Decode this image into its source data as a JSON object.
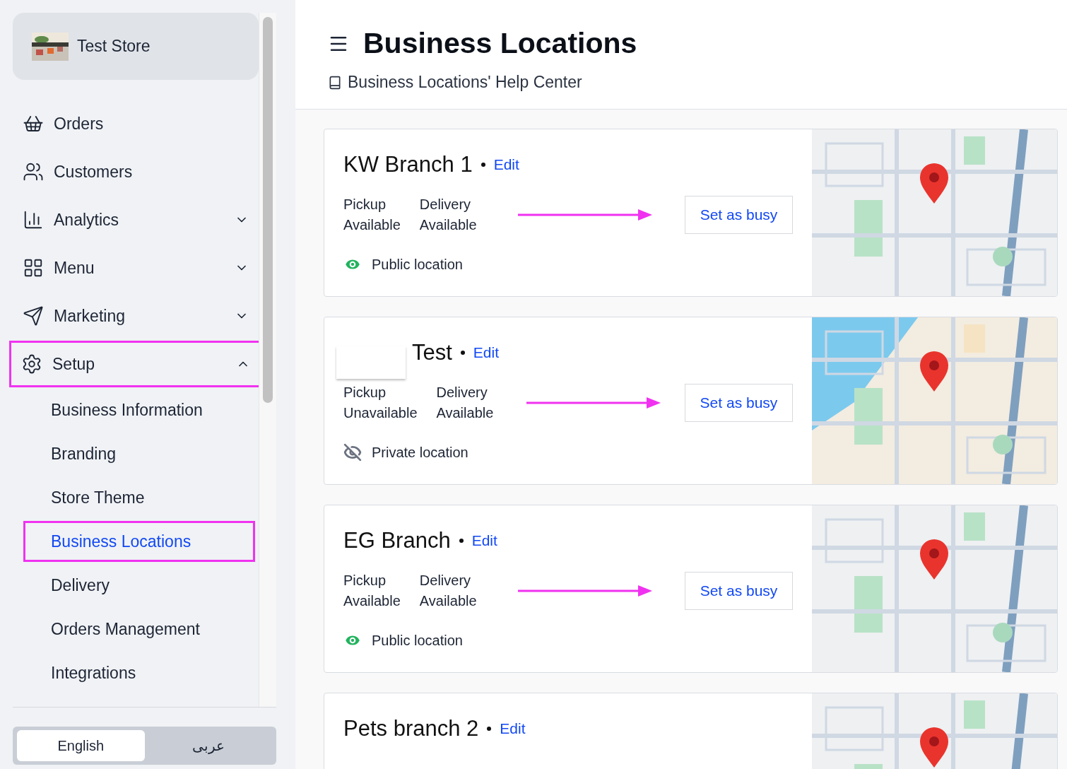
{
  "store": {
    "name": "Test Store"
  },
  "nav": [
    {
      "kind": "link",
      "label": "Orders",
      "highlighted": false
    },
    {
      "kind": "link",
      "label": "Customers",
      "highlighted": false
    },
    {
      "kind": "group",
      "label": "Analytics",
      "expanded": false,
      "highlighted": false
    },
    {
      "kind": "group",
      "label": "Menu",
      "expanded": false,
      "highlighted": false
    },
    {
      "kind": "group",
      "label": "Marketing",
      "expanded": false,
      "highlighted": false
    },
    {
      "kind": "group",
      "label": "Setup",
      "expanded": true,
      "highlighted": true,
      "children": [
        {
          "label": "Business Information",
          "selected": false,
          "highlighted": false
        },
        {
          "label": "Branding",
          "selected": false,
          "highlighted": false
        },
        {
          "label": "Store Theme",
          "selected": false,
          "highlighted": false
        },
        {
          "label": "Business Locations",
          "selected": true,
          "highlighted": true
        },
        {
          "label": "Delivery",
          "selected": false,
          "highlighted": false
        },
        {
          "label": "Orders Management",
          "selected": false,
          "highlighted": false
        },
        {
          "label": "Integrations",
          "selected": false,
          "highlighted": false
        }
      ]
    }
  ],
  "languages": [
    {
      "label": "English",
      "selected": true
    },
    {
      "label": "عربى",
      "selected": false
    }
  ],
  "header": {
    "title": "Business Locations",
    "help_link": "Business Locations' Help Center"
  },
  "locations": [
    {
      "name": "KW Branch 1",
      "edit": "Edit",
      "logo": false,
      "pickup": {
        "label": "Pickup",
        "status": "Available"
      },
      "delivery": {
        "label": "Delivery",
        "status": "Available"
      },
      "visibility": {
        "public": true,
        "label": "Public location"
      },
      "action": "Set as busy",
      "arrow": true
    },
    {
      "name": "Test",
      "edit": "Edit",
      "logo": true,
      "pickup": {
        "label": "Pickup",
        "status": "Unavailable"
      },
      "delivery": {
        "label": "Delivery",
        "status": "Available"
      },
      "visibility": {
        "public": false,
        "label": "Private location"
      },
      "action": "Set as busy",
      "arrow": true
    },
    {
      "name": "EG Branch",
      "edit": "Edit",
      "logo": false,
      "pickup": {
        "label": "Pickup",
        "status": "Available"
      },
      "delivery": {
        "label": "Delivery",
        "status": "Available"
      },
      "visibility": {
        "public": true,
        "label": "Public location"
      },
      "action": "Set as busy",
      "arrow": true
    },
    {
      "name": "Pets branch 2",
      "edit": "Edit",
      "logo": false
    }
  ]
}
